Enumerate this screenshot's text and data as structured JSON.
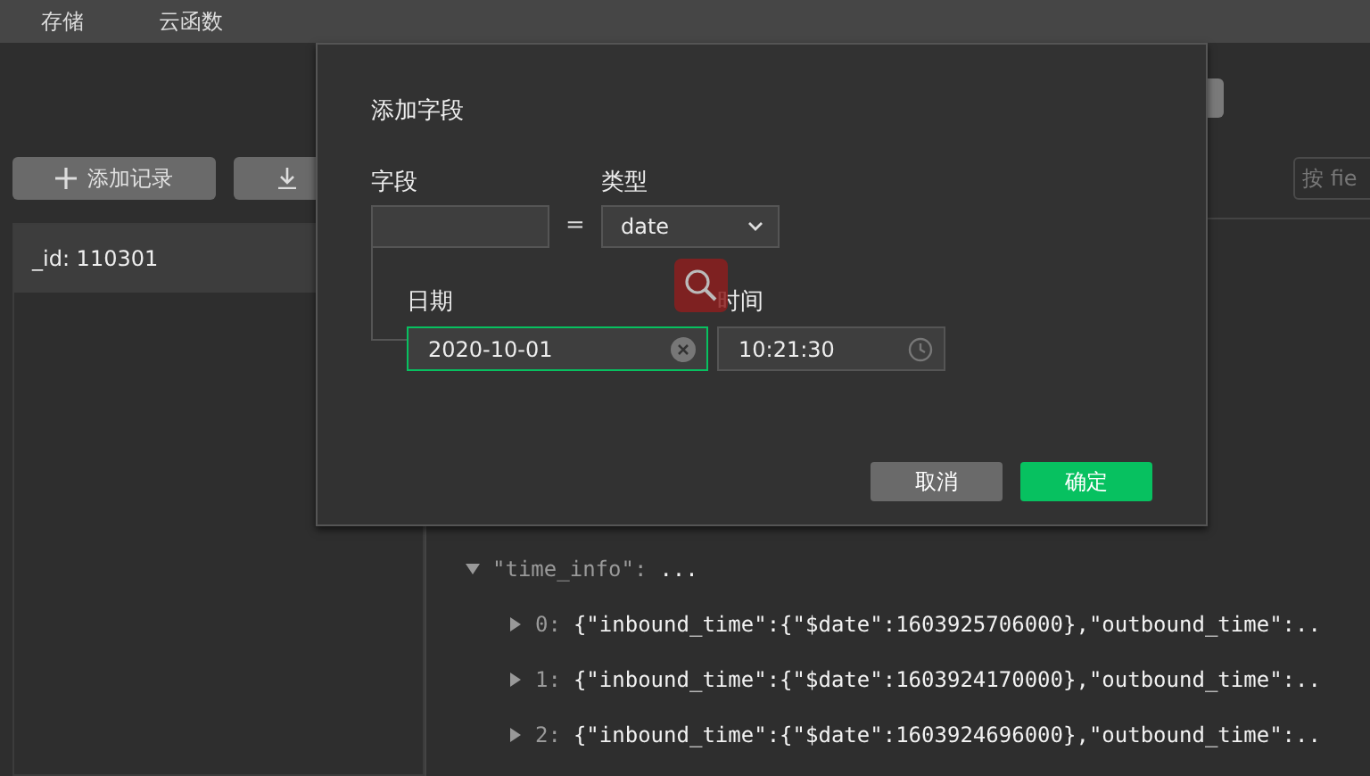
{
  "top_menu": [
    "存储",
    "云函数"
  ],
  "toolbar": {
    "add_button": "添加记录"
  },
  "records": [
    {
      "label": "_id: 110301",
      "selected": true
    }
  ],
  "search": {
    "placeholder": "按 fie"
  },
  "dialog": {
    "title": "添加字段",
    "field_label": "字段",
    "equals": "=",
    "type_label": "类型",
    "type_value": "date",
    "date_label": "日期",
    "date_value": "2020-10-01",
    "date_focused": true,
    "time_label": "时间",
    "time_value": "10:21:30",
    "cancel": "取消",
    "confirm": "确定"
  },
  "json_view": {
    "key": "\"time_info\":",
    "summary": "...",
    "expanded": true,
    "children": [
      {
        "index": "0:",
        "value": "{\"inbound_time\":{\"$date\":1603925706000},\"outbound_time\":..",
        "expanded": false
      },
      {
        "index": "1:",
        "value": "{\"inbound_time\":{\"$date\":1603924170000},\"outbound_time\":..",
        "expanded": false
      },
      {
        "index": "2:",
        "value": "{\"inbound_time\":{\"$date\":1603924696000},\"outbound_time\":..",
        "expanded": false
      }
    ]
  }
}
